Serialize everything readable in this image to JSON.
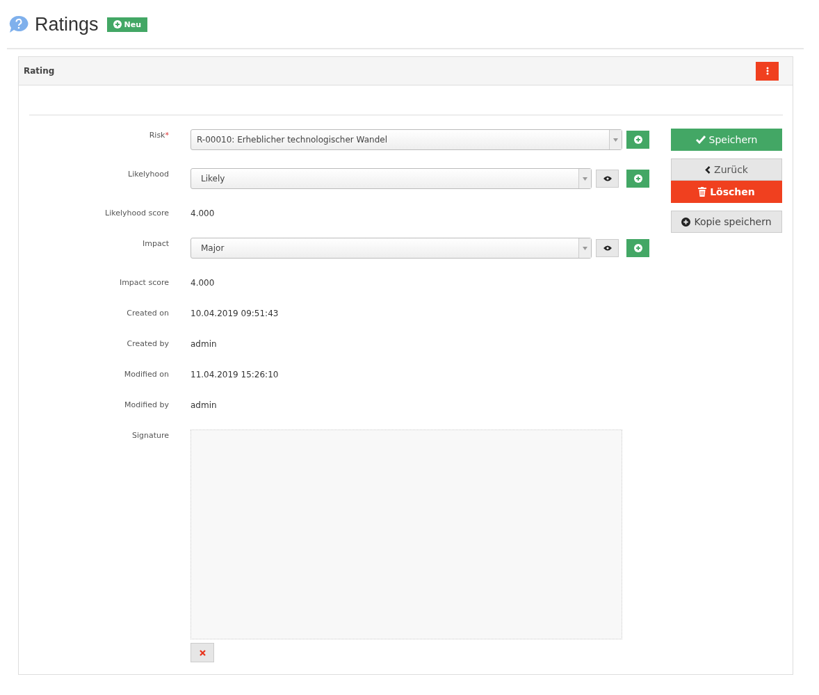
{
  "page_title": "Ratings",
  "new_button": "Neu",
  "panel": {
    "title": "Rating"
  },
  "fields": [
    {
      "kind": "select",
      "label": "Risk",
      "required_mark": "*",
      "value": "R-00010: Erheblicher technologischer Wandel",
      "view_button": false,
      "add_button": true
    },
    {
      "kind": "select",
      "label": "Likelyhood",
      "value": "Likely",
      "view_button": true,
      "add_button": true
    },
    {
      "kind": "text",
      "label": "Likelyhood score",
      "value": "4.000"
    },
    {
      "kind": "select",
      "label": "Impact",
      "value": "Major",
      "view_button": true,
      "add_button": true
    },
    {
      "kind": "text",
      "label": "Impact score",
      "value": "4.000"
    },
    {
      "kind": "text",
      "label": "Created on",
      "value": "10.04.2019 09:51:43"
    },
    {
      "kind": "text",
      "label": "Created by",
      "value": "admin"
    },
    {
      "kind": "text",
      "label": "Modified on",
      "value": "11.04.2019 15:26:10"
    },
    {
      "kind": "text",
      "label": "Modified by",
      "value": "admin"
    },
    {
      "kind": "signature",
      "label": "Signature"
    }
  ],
  "actions": [
    {
      "kind": "save",
      "label": "Speichern"
    },
    {
      "kind": "back",
      "label": "Zurück"
    },
    {
      "kind": "delete",
      "label": "Löschen"
    },
    {
      "kind": "copy",
      "label": "Kopie speichern"
    }
  ]
}
